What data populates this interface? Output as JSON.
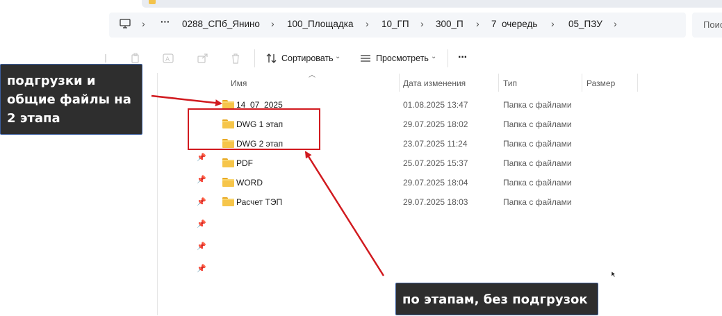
{
  "breadcrumb": {
    "overflow": "···",
    "items": [
      "0288_СПб_Янино",
      "100_Площадка",
      "10_ГП",
      "300_П",
      "7  очередь",
      "05_ПЗУ"
    ]
  },
  "search": {
    "placeholder": "Поис"
  },
  "toolbar": {
    "sort_label": "Сортировать",
    "view_label": "Просмотреть",
    "more_label": "···"
  },
  "columns": {
    "name": "Имя",
    "date": "Дата изменения",
    "type": "Тип",
    "size": "Размер"
  },
  "files": [
    {
      "name": "14_07_2025",
      "date": "01.08.2025 13:47",
      "type": "Папка с файлами"
    },
    {
      "name": "DWG 1 этап",
      "date": "29.07.2025 18:02",
      "type": "Папка с файлами"
    },
    {
      "name": "DWG 2 этап",
      "date": "23.07.2025 11:24",
      "type": "Папка с файлами"
    },
    {
      "name": "PDF",
      "date": "25.07.2025 15:37",
      "type": "Папка с файлами"
    },
    {
      "name": "WORD",
      "date": "29.07.2025 18:04",
      "type": "Папка с файлами"
    },
    {
      "name": "Расчет ТЭП",
      "date": "29.07.2025 18:03",
      "type": "Папка с файлами"
    }
  ],
  "annotations": {
    "left_note": [
      "подгрузки и",
      "общие файлы на",
      "2 этапа"
    ],
    "bottom_note": "по этапам, без подгрузок"
  },
  "colors": {
    "annotation_red": "#d11a1f",
    "callout_bg": "#2e2e2e",
    "folder_yellow": "#f6c54a"
  }
}
